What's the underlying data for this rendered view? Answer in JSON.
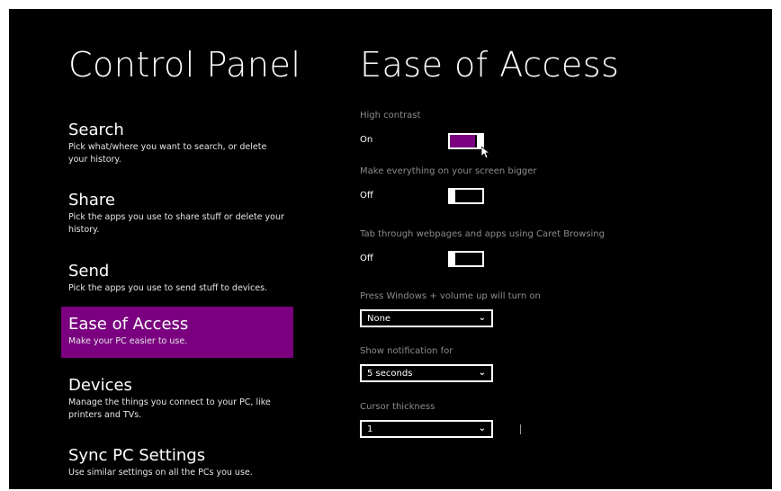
{
  "left_title": "Control Panel",
  "right_title": "Ease of Access",
  "nav": [
    {
      "label": "Search",
      "desc": "Pick what/where you want to search, or delete your history."
    },
    {
      "label": "Share",
      "desc": "Pick the apps you use to share stuff or delete your history."
    },
    {
      "label": "Send",
      "desc": "Pick the apps you use to send stuff to devices."
    },
    {
      "label": "Ease of Access",
      "desc": "Make your PC easier to use."
    },
    {
      "label": "Devices",
      "desc": "Manage the things you connect to your PC, like printers and TVs."
    },
    {
      "label": "Sync PC Settings",
      "desc": "Use similar settings on all the PCs you use."
    }
  ],
  "settings": {
    "high_contrast": {
      "label": "High contrast",
      "state": "On",
      "on": true
    },
    "bigger": {
      "label": "Make everything on your screen bigger",
      "state": "Off",
      "on": false
    },
    "caret": {
      "label": "Tab through webpages and apps using Caret Browsing",
      "state": "Off",
      "on": false
    },
    "volume_shortcut": {
      "label": "Press Windows + volume up will turn on",
      "value": "None"
    },
    "notification": {
      "label": "Show notification for",
      "value": "5 seconds"
    },
    "cursor_thickness": {
      "label": "Cursor thickness",
      "value": "1"
    }
  },
  "colors": {
    "accent": "#7a0080",
    "background": "#000000"
  },
  "icons": {
    "dropdown": "chevron-down-icon",
    "pointer": "mouse-pointer-icon"
  }
}
